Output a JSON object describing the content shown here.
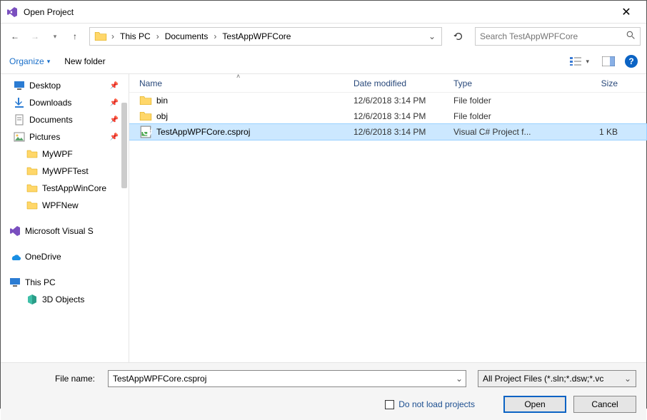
{
  "title": "Open Project",
  "breadcrumb": {
    "root": "This PC",
    "mid": "Documents",
    "leaf": "TestAppWPFCore"
  },
  "search": {
    "placeholder": "Search TestAppWPFCore"
  },
  "toolbar": {
    "organize": "Organize",
    "newfolder": "New folder"
  },
  "columns": {
    "name": "Name",
    "date": "Date modified",
    "type": "Type",
    "size": "Size"
  },
  "sidebar": {
    "desktop": "Desktop",
    "downloads": "Downloads",
    "documents": "Documents",
    "pictures": "Pictures",
    "mywpf": "MyWPF",
    "mywpftest": "MyWPFTest",
    "testappwincore": "TestAppWinCore",
    "wpfnew": "WPFNew",
    "vs": "Microsoft Visual S",
    "onedrive": "OneDrive",
    "thispc": "This PC",
    "threed": "3D Objects"
  },
  "rows": [
    {
      "name": "bin",
      "date": "12/6/2018 3:14 PM",
      "type": "File folder",
      "size": "",
      "kind": "folder",
      "selected": false
    },
    {
      "name": "obj",
      "date": "12/6/2018 3:14 PM",
      "type": "File folder",
      "size": "",
      "kind": "folder",
      "selected": false
    },
    {
      "name": "TestAppWPFCore.csproj",
      "date": "12/6/2018 3:14 PM",
      "type": "Visual C# Project f...",
      "size": "1 KB",
      "kind": "csproj",
      "selected": true
    }
  ],
  "footer": {
    "filename_label": "File name:",
    "filename_value": "TestAppWPFCore.csproj",
    "filter": "All Project Files (*.sln;*.dsw;*.vc",
    "donotload": "Do not load projects",
    "open": "Open",
    "cancel": "Cancel"
  }
}
